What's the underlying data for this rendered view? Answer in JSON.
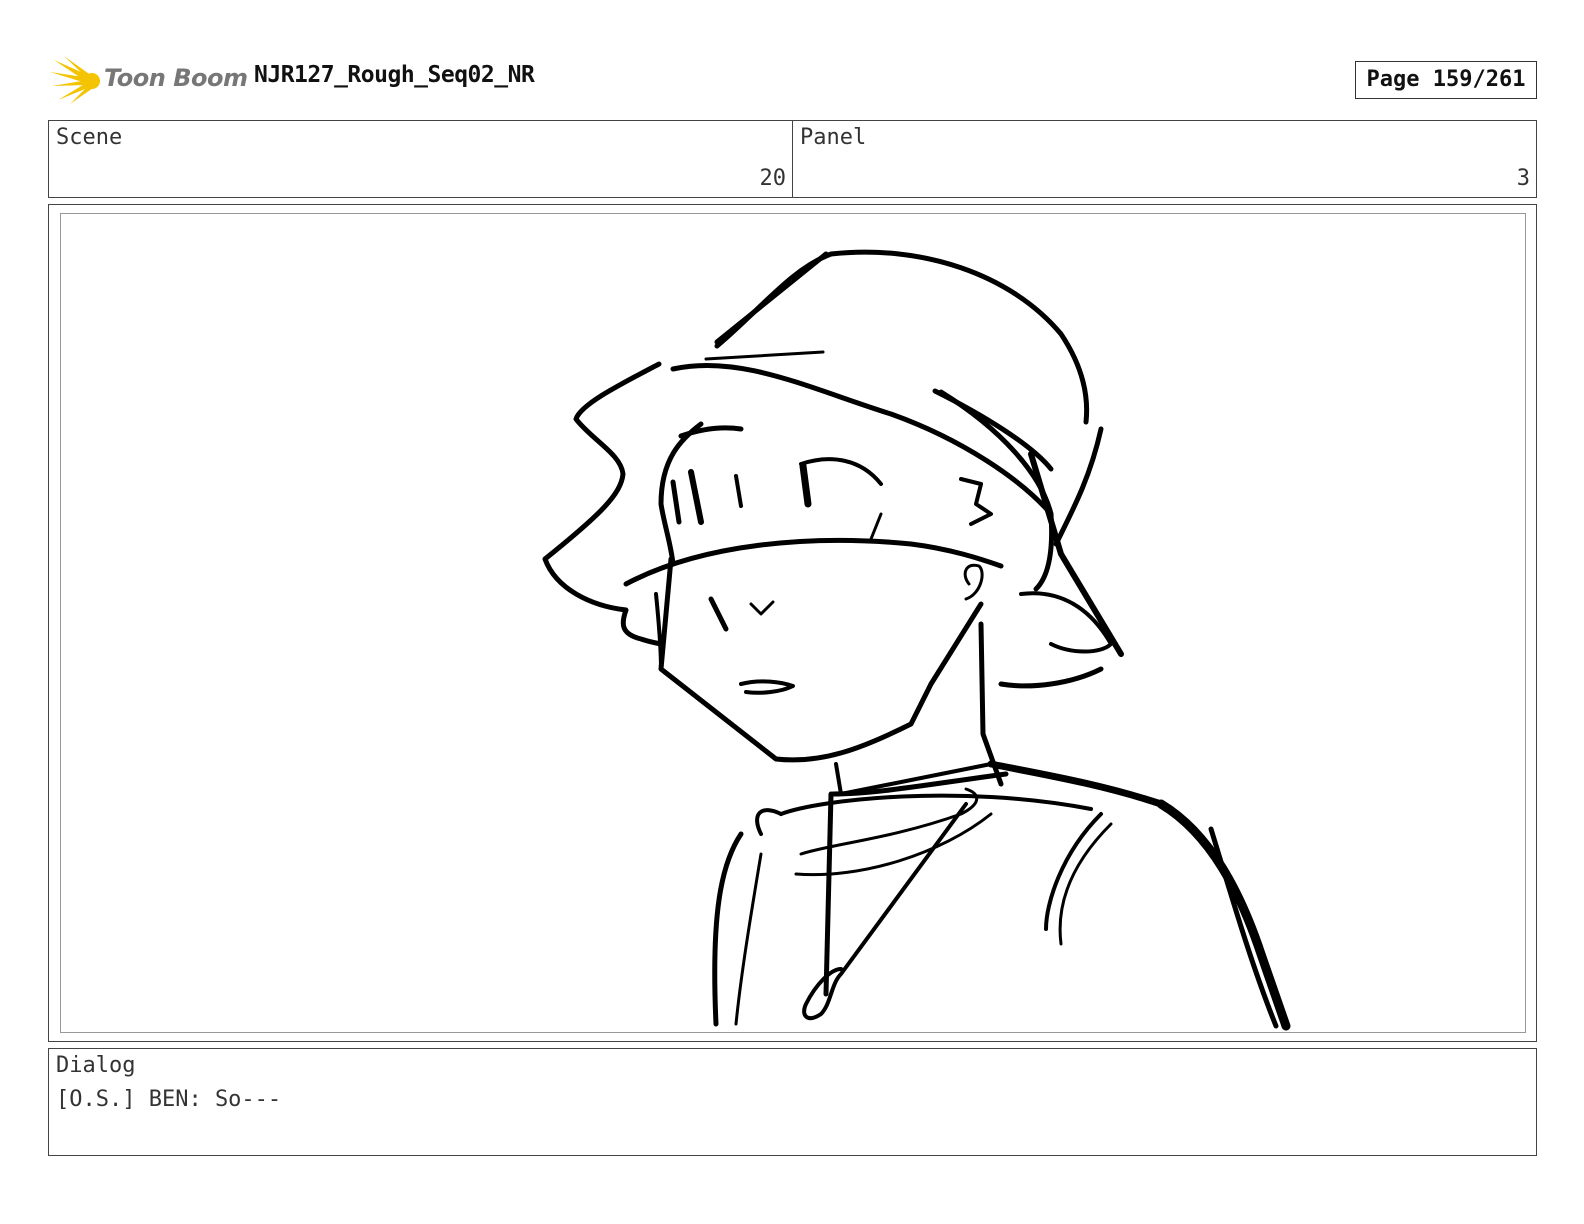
{
  "header": {
    "logo_text": "Toon Boom",
    "document_title": "NJR127_Rough_Seq02_NR",
    "page_indicator": "Page 159/261"
  },
  "info": {
    "scene_label": "Scene",
    "scene_value": "20",
    "panel_label": "Panel",
    "panel_value": "3"
  },
  "panel": {
    "sketch_icon": "character-sketch"
  },
  "dialog": {
    "label": "Dialog",
    "text": "[O.S.] BEN: So---"
  },
  "colors": {
    "logo_burst": "#f5c400",
    "logo_text": "#777777",
    "border": "#444444",
    "ink": "#000000"
  }
}
